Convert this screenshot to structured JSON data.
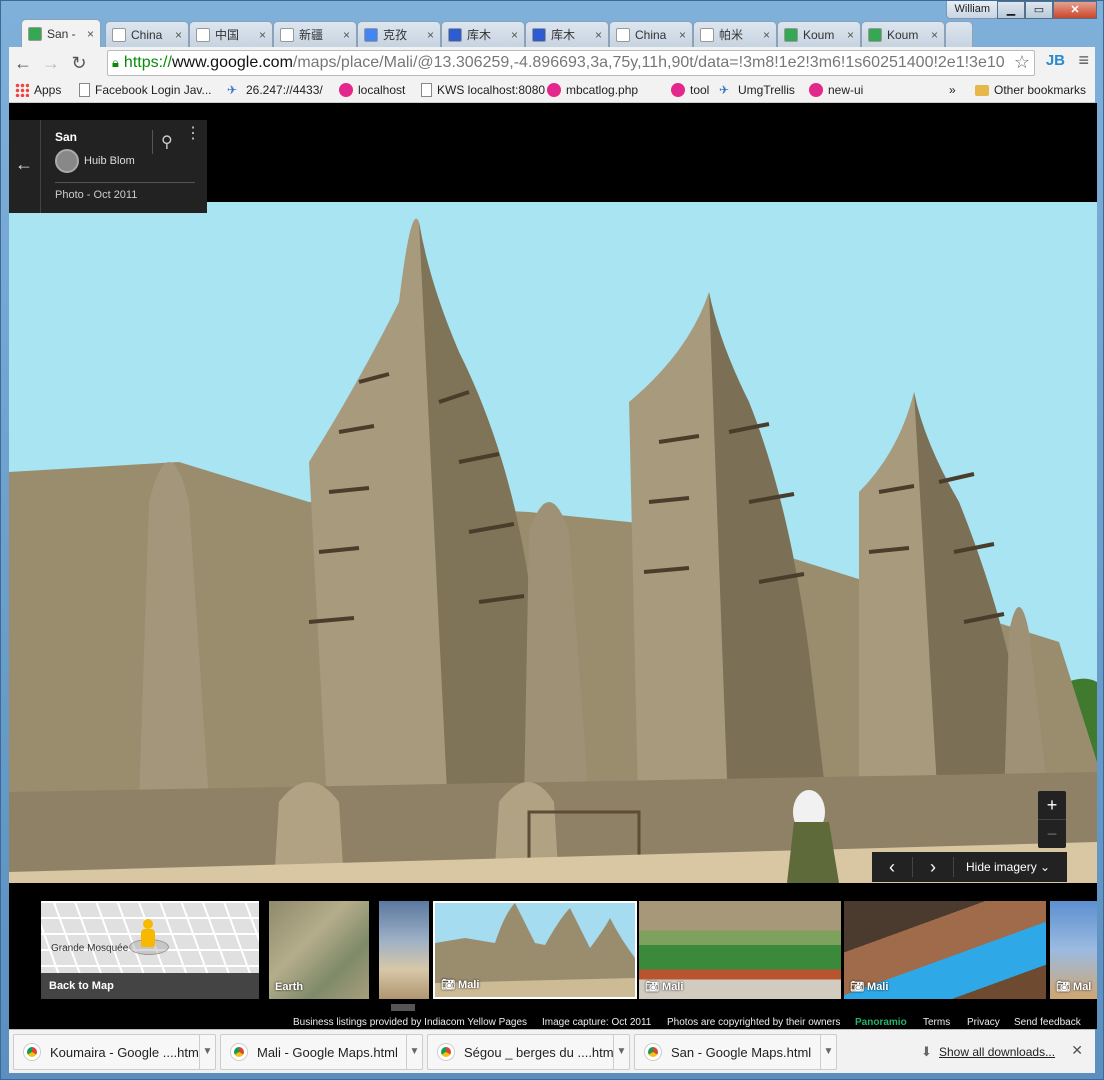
{
  "window": {
    "user": "William",
    "controls": {
      "minimize": "▁",
      "maximize": "▭",
      "close": "✕"
    }
  },
  "tabs": [
    {
      "title": "San -",
      "icon": "google-maps-icon",
      "active": true
    },
    {
      "title": "China",
      "icon": "page-icon"
    },
    {
      "title": "中国",
      "icon": "page-icon"
    },
    {
      "title": "新疆",
      "icon": "page-icon"
    },
    {
      "title": "克孜",
      "icon": "google-icon"
    },
    {
      "title": "库木",
      "icon": "paw-icon"
    },
    {
      "title": "库木",
      "icon": "paw-icon"
    },
    {
      "title": "China",
      "icon": "page-icon"
    },
    {
      "title": "帕米",
      "icon": "wikipedia-icon"
    },
    {
      "title": "Koum",
      "icon": "google-maps-icon"
    },
    {
      "title": "Koum",
      "icon": "google-maps-icon"
    }
  ],
  "toolbar": {
    "back": "←",
    "forward": "→",
    "reload": "↻",
    "url_scheme": "https://",
    "url_host": "www.google.com",
    "url_path": "/maps/place/Mali/@13.306259,-4.896693,3a,75y,11h,90t/data=!3m8!1e2!3m6!1s60251400!2e1!3e10",
    "star": "☆",
    "extension": "JB",
    "menu": "≡"
  },
  "bookmarks": [
    {
      "label": "Apps",
      "icon": "apps-icon"
    },
    {
      "label": "Facebook Login Jav...",
      "icon": "page-icon"
    },
    {
      "label": "26.247://4433/",
      "icon": "satellite-icon"
    },
    {
      "label": "localhost",
      "icon": "pink-icon"
    },
    {
      "label": "KWS localhost:8080",
      "icon": "page-icon"
    },
    {
      "label": "mbcatlog.php",
      "icon": "pink-icon"
    },
    {
      "label": "tool",
      "icon": "pink-icon"
    },
    {
      "label": "UmgTrellis",
      "icon": "satellite-icon"
    },
    {
      "label": "new-ui",
      "icon": "pink-icon"
    },
    {
      "label": "»",
      "icon": ""
    },
    {
      "label": "Other bookmarks",
      "icon": "folder-icon"
    }
  ],
  "info_card": {
    "back": "←",
    "place": "San",
    "author": "Huib Blom",
    "date": "Photo - Oct 2011",
    "pin": "⚲",
    "more": "⋮"
  },
  "viewer": {
    "zoom_in": "+",
    "zoom_out": "−",
    "prev": "‹",
    "next": "›",
    "hide_imagery": "Hide imagery ⌄"
  },
  "filmstrip": {
    "map_label": "Grande Mosquée",
    "back_to_map": "Back to Map",
    "items": [
      {
        "label": "Earth"
      },
      {
        "label": ""
      },
      {
        "label": "Mali",
        "selected": true
      },
      {
        "label": "Mali"
      },
      {
        "label": "Mali"
      },
      {
        "label": "Mal"
      }
    ]
  },
  "attribution": {
    "listings": "Business listings provided by Indiacom Yellow Pages",
    "capture": "Image capture: Oct 2011",
    "copyright": "Photos are copyrighted by their owners",
    "panoramio": "Panoramio",
    "terms": "Terms",
    "privacy": "Privacy",
    "feedback": "Send feedback"
  },
  "downloads": {
    "items": [
      "Koumaira - Google ....html",
      "Mali - Google Maps.html",
      "Ségou _ berges du ....html",
      "San - Google Maps.html"
    ],
    "show_all": "Show all downloads...",
    "close": "✕"
  },
  "colors": {
    "sky": "#a8e4f2",
    "mud_wall": "#9a8d6e",
    "panel": "#222222",
    "panoramio": "#23b26b"
  }
}
